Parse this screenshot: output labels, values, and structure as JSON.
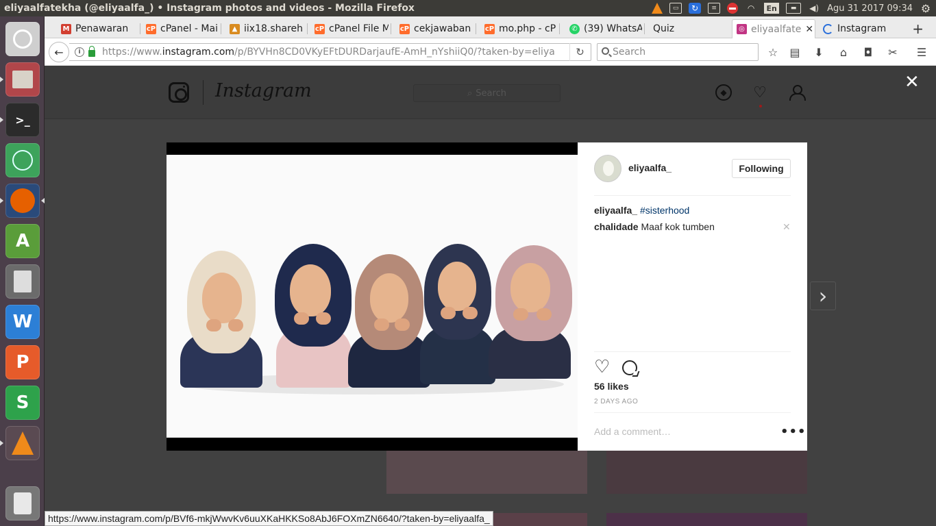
{
  "panel": {
    "window_title": "eliyaalfatekha (@eliyaalfa_) • Instagram photos and videos - Mozilla Firefox",
    "keyboard_layout": "En",
    "clock": "Agu 31 2017 09:34"
  },
  "launcher": {
    "items": [
      {
        "name": "Ubuntu Dash",
        "icon": "ubuntu-logo-icon",
        "color": "#cfcfcf"
      },
      {
        "name": "Files",
        "icon": "file-cabinet-icon",
        "color": "#b1464a"
      },
      {
        "name": "Terminal",
        "icon": "terminal-icon",
        "color": "#2b2b2b"
      },
      {
        "name": "Atom",
        "icon": "atom-icon",
        "color": "#3da35b"
      },
      {
        "name": "Firefox",
        "icon": "firefox-icon",
        "color": "#e66000"
      },
      {
        "name": "Android Studio",
        "icon": "android-studio-icon",
        "color": "#5a9d3a"
      },
      {
        "name": "Calculator",
        "icon": "calculator-icon",
        "color": "#6b6b6b"
      },
      {
        "name": "WPS Writer",
        "icon": "wps-writer-icon",
        "color": "#2c7fd6",
        "glyph": "W"
      },
      {
        "name": "WPS Presentation",
        "icon": "wps-presentation-icon",
        "color": "#e65b2a",
        "glyph": "P"
      },
      {
        "name": "WPS Spreadsheets",
        "icon": "wps-spreadsheet-icon",
        "color": "#2ea24b",
        "glyph": "S"
      },
      {
        "name": "VLC",
        "icon": "vlc-icon",
        "color": "#f08a1a"
      },
      {
        "name": "Trash",
        "icon": "trash-icon",
        "color": "#777"
      }
    ]
  },
  "browser": {
    "tabs": [
      {
        "label": "Penawaran",
        "icon": "gmail-icon",
        "color": "#d23f31"
      },
      {
        "label": "cPanel - Mai",
        "icon": "cpanel-icon",
        "color": "#ff6c2c"
      },
      {
        "label": "iix18.shareh",
        "icon": "share-icon",
        "color": "#d98b1f"
      },
      {
        "label": "cPanel File M",
        "icon": "cpanel-icon",
        "color": "#ff6c2c"
      },
      {
        "label": "cekjawaban",
        "icon": "cpanel-icon",
        "color": "#ff6c2c"
      },
      {
        "label": "mo.php - cP",
        "icon": "cpanel-icon",
        "color": "#ff6c2c"
      },
      {
        "label": "(39) WhatsA",
        "icon": "whatsapp-icon",
        "color": "#25d366"
      },
      {
        "label": "Quiz",
        "icon": "",
        "color": ""
      },
      {
        "label": "eliyaalfate",
        "icon": "instagram-icon",
        "color": "#c13584",
        "active": true
      },
      {
        "label": "Instagram",
        "icon": "loading-icon",
        "color": "#2a6fdb"
      }
    ],
    "url_prefix": "https://www.",
    "url_host": "instagram.com",
    "url_path": "/p/BYVHn8CD0VKyEFtDURDarjaufE-AmH_nYshiiQ0/?taken-by=eliya",
    "search_placeholder": "Search",
    "status_link": "https://www.instagram.com/p/BVf6-mkjWwvKv6uuXKaHKKSo8AbJ6FOXmZN6640/?taken-by=eliyaalfa_"
  },
  "instagram": {
    "wordmark": "Instagram",
    "search_placeholder": "Search",
    "post": {
      "author": "eliyaalfa_",
      "follow_label": "Following",
      "caption_user": "eliyaalfa_",
      "caption_text": "#sisterhood",
      "comments": [
        {
          "user": "chalidade",
          "text": "Maaf kok tumben"
        }
      ],
      "likes": "56 likes",
      "time_ago": "2 DAYS AGO",
      "add_comment_placeholder": "Add a comment…",
      "more_label": "•••"
    },
    "close_label": "✕"
  }
}
